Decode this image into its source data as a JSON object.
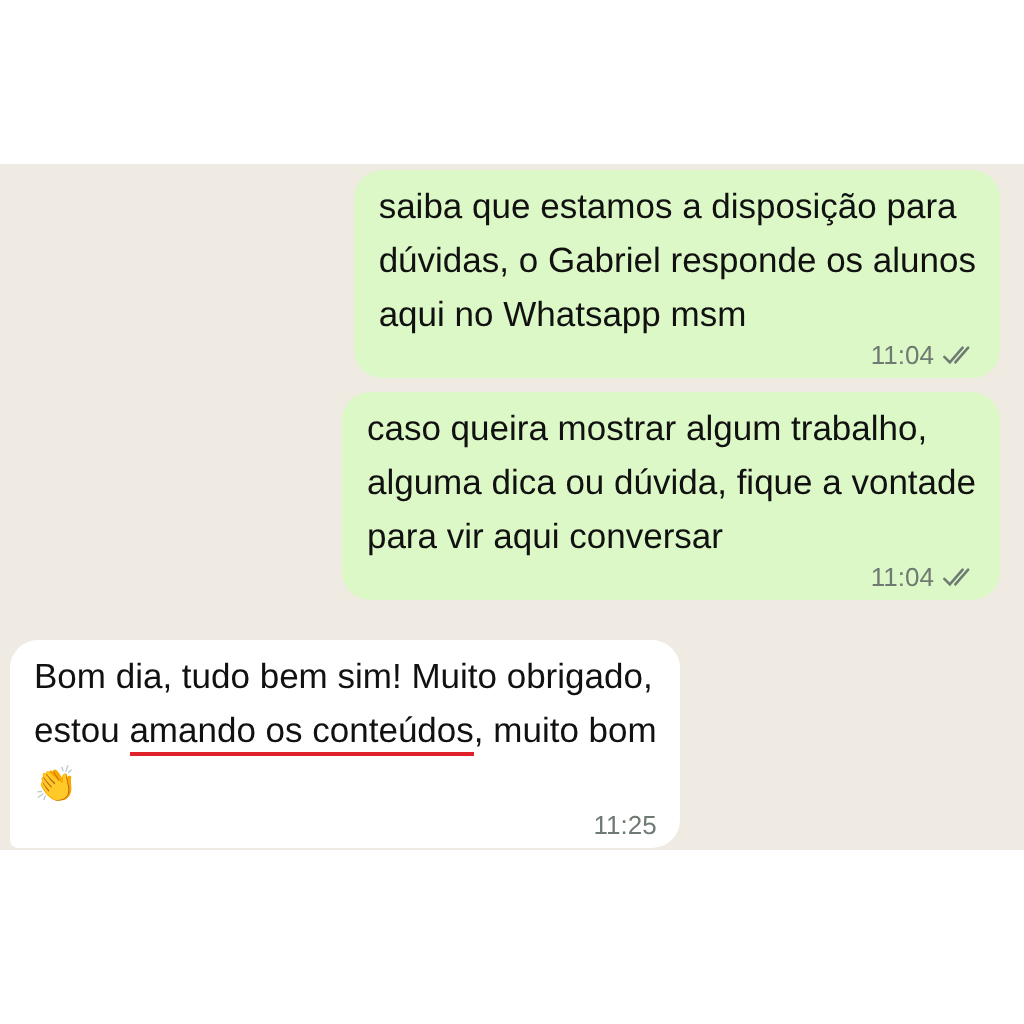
{
  "messages": [
    {
      "kind": "outgoing",
      "segments": [
        {
          "text": "saiba que estamos a disposição para\ndúvidas, o Gabriel responde os alunos\naqui no Whatsapp msm",
          "underlined": false
        }
      ],
      "time": "11:04",
      "read": false
    },
    {
      "kind": "outgoing",
      "segments": [
        {
          "text": "caso queira mostrar algum trabalho,\nalguma dica ou dúvida, fique a vontade\npara vir aqui conversar",
          "underlined": false
        }
      ],
      "time": "11:04",
      "read": false
    },
    {
      "kind": "incoming",
      "segments": [
        {
          "text": "Bom dia, tudo bem sim! Muito obrigado,\nestou ",
          "underlined": false
        },
        {
          "text": "amando os conteúdos",
          "underlined": true
        },
        {
          "text": ", muito bom\n👏",
          "underlined": false
        }
      ],
      "time": "11:25"
    }
  ]
}
